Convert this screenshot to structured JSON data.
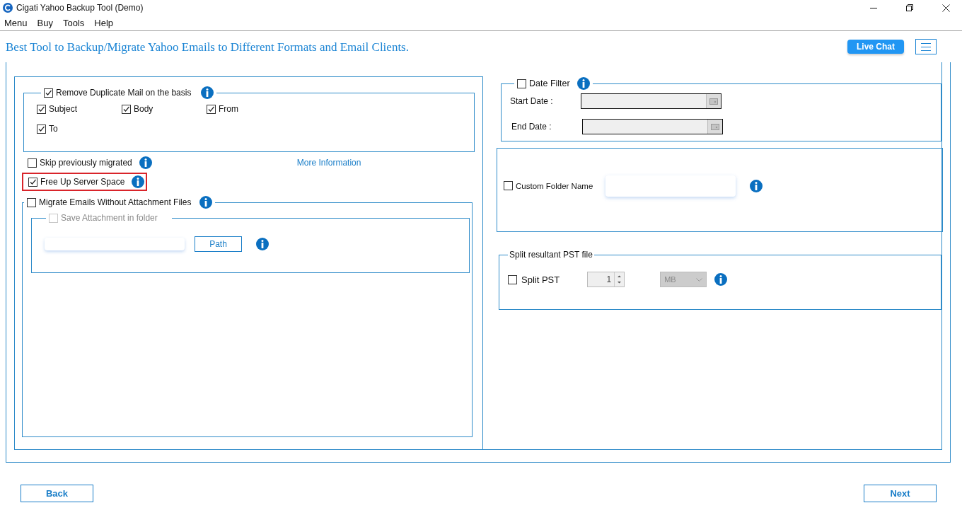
{
  "window": {
    "title": "Cigati Yahoo Backup Tool (Demo)"
  },
  "menu": [
    "Menu",
    "Buy",
    "Tools",
    "Help"
  ],
  "tagline": "Best Tool to Backup/Migrate Yahoo Emails to Different Formats and Email Clients.",
  "live_chat": "Live Chat",
  "remove_duplicates": {
    "label": "Remove Duplicate Mail on the basis",
    "checked": true,
    "options": [
      {
        "label": "Subject",
        "checked": true
      },
      {
        "label": "Body",
        "checked": true
      },
      {
        "label": "From",
        "checked": true
      },
      {
        "label": "To",
        "checked": true
      }
    ]
  },
  "skip_previously_migrated": {
    "label": "Skip previously migrated",
    "checked": false
  },
  "more_information": "More Information",
  "free_up_server_space": {
    "label": "Free Up Server Space",
    "checked": true,
    "highlighted": true
  },
  "migrate_without_attachments": {
    "label": "Migrate Emails Without Attachment Files",
    "checked": false
  },
  "save_attachment": {
    "label": "Save Attachment in folder",
    "checked": false,
    "disabled": true,
    "path_button": "Path"
  },
  "date_filter": {
    "label": "Date Filter",
    "checked": false,
    "fields": [
      {
        "label": "Start Date :"
      },
      {
        "label": "End Date :"
      }
    ]
  },
  "custom_folder": {
    "label": "Custom Folder Name",
    "checked": false
  },
  "split": {
    "title": "Split resultant PST file",
    "label": "Split PST",
    "checked": false,
    "size": "1",
    "unit": "MB"
  },
  "buttons": {
    "back": "Back",
    "next": "Next"
  }
}
